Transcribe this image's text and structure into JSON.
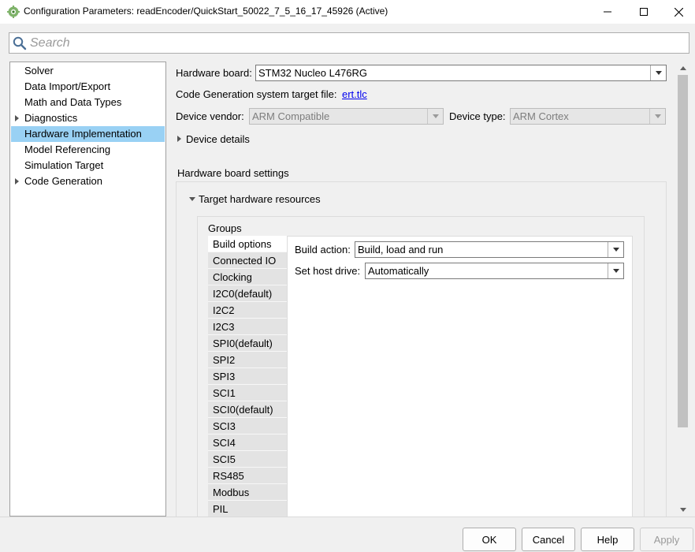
{
  "window": {
    "title": "Configuration Parameters: readEncoder/QuickStart_50022_7_5_16_17_45926 (Active)",
    "icon": "gear-icon"
  },
  "search": {
    "placeholder": "Search"
  },
  "nav": {
    "items": [
      {
        "label": "Solver",
        "expandable": false
      },
      {
        "label": "Data Import/Export",
        "expandable": false
      },
      {
        "label": "Math and Data Types",
        "expandable": false
      },
      {
        "label": "Diagnostics",
        "expandable": true
      },
      {
        "label": "Hardware Implementation",
        "expandable": false,
        "selected": true
      },
      {
        "label": "Model Referencing",
        "expandable": false
      },
      {
        "label": "Simulation Target",
        "expandable": false
      },
      {
        "label": "Code Generation",
        "expandable": true
      }
    ]
  },
  "hardware": {
    "board_label": "Hardware board:",
    "board_value": "STM32 Nucleo L476RG",
    "target_file_label": "Code Generation system target file:",
    "target_file_link": "ert.tlc",
    "vendor_label": "Device vendor:",
    "vendor_value": "ARM Compatible",
    "type_label": "Device type:",
    "type_value": "ARM Cortex",
    "device_details": "Device details",
    "board_settings_title": "Hardware board settings",
    "target_resources": "Target hardware resources",
    "groups_title": "Groups",
    "groups": [
      "Build options",
      "Connected IO",
      "Clocking",
      "I2C0(default)",
      "I2C2",
      "I2C3",
      "SPI0(default)",
      "SPI2",
      "SPI3",
      "SCI1",
      "SCI0(default)",
      "SCI3",
      "SCI4",
      "SCI5",
      "RS485",
      "Modbus",
      "PIL"
    ],
    "active_group": "Build options",
    "build_action_label": "Build action:",
    "build_action_value": "Build, load and run",
    "host_drive_label": "Set host drive:",
    "host_drive_value": "Automatically"
  },
  "buttons": {
    "ok": "OK",
    "cancel": "Cancel",
    "help": "Help",
    "apply": "Apply"
  },
  "colors": {
    "selection": "#99d1f4",
    "link": "#0000ee"
  }
}
